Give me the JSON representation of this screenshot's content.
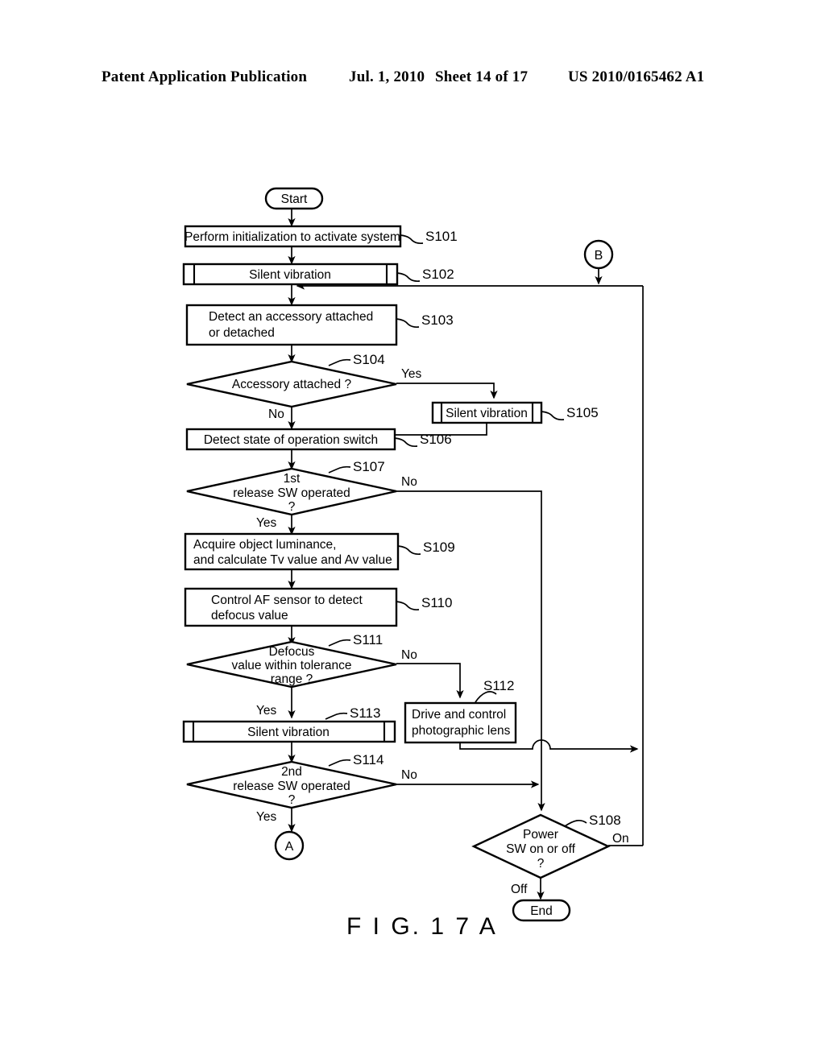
{
  "header": {
    "publication": "Patent Application Publication",
    "date": "Jul. 1, 2010",
    "sheet": "Sheet 14 of 17",
    "number": "US 2010/0165462 A1"
  },
  "figure": {
    "label": "F I G. 1 7 A"
  },
  "terminators": {
    "start": "Start",
    "end": "End"
  },
  "connectors": {
    "a": "A",
    "b": "B"
  },
  "nodes": {
    "s101": {
      "step": "S101",
      "text": "Perform initialization to activate system"
    },
    "s102": {
      "step": "S102",
      "text": "Silent vibration"
    },
    "s103": {
      "step": "S103",
      "line1": "Detect an accessory attached",
      "line2": "or detached"
    },
    "s104": {
      "step": "S104",
      "text": "Accessory attached ?"
    },
    "s105": {
      "step": "S105",
      "text": "Silent vibration"
    },
    "s106": {
      "step": "S106",
      "text": "Detect state of operation switch"
    },
    "s107": {
      "step": "S107",
      "line1": "1st",
      "line2": "release SW operated",
      "line3": "?"
    },
    "s108": {
      "step": "S108",
      "line1": "Power",
      "line2": "SW on or off",
      "line3": "?"
    },
    "s109": {
      "step": "S109",
      "line1": "Acquire object luminance,",
      "line2": "and calculate Tv value and Av value"
    },
    "s110": {
      "step": "S110",
      "line1": "Control AF sensor to detect",
      "line2": "defocus value"
    },
    "s111": {
      "step": "S111",
      "line1": "Defocus",
      "line2": "value within tolerance",
      "line3": "range ?"
    },
    "s112": {
      "step": "S112",
      "line1": "Drive and control",
      "line2": "photographic lens"
    },
    "s113": {
      "step": "S113",
      "text": "Silent vibration"
    },
    "s114": {
      "step": "S114",
      "line1": "2nd",
      "line2": "release SW operated",
      "line3": "?"
    }
  },
  "edge_labels": {
    "s104_yes": "Yes",
    "s104_no": "No",
    "s107_yes": "Yes",
    "s107_no": "No",
    "s111_yes": "Yes",
    "s111_no": "No",
    "s114_yes": "Yes",
    "s114_no": "No",
    "s108_on": "On",
    "s108_off": "Off"
  },
  "colors": {
    "ink": "#000000",
    "paper": "#ffffff"
  }
}
